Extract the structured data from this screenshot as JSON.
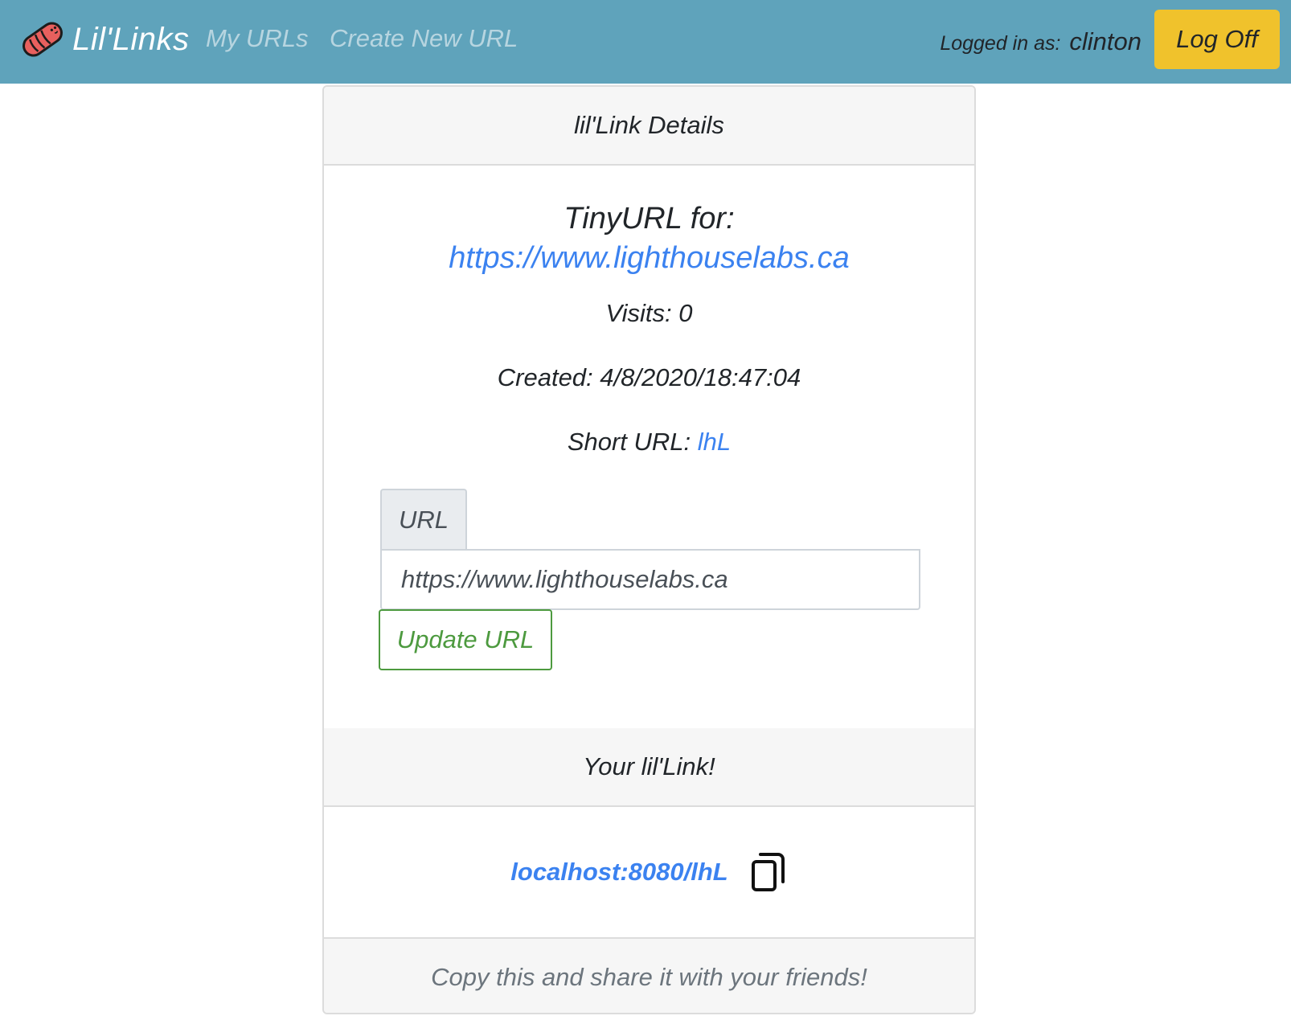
{
  "navbar": {
    "brand_text": "Lil'Links",
    "brand_icon": "sausage-icon",
    "links": [
      "My URLs",
      "Create New URL"
    ],
    "logged_in_label": "Logged in as:",
    "username": "clinton",
    "logoff_label": "Log Off",
    "colors": {
      "background": "#5fa3bb",
      "logoff": "#f0c22c"
    }
  },
  "details": {
    "header": "lil'Link Details",
    "tiny_title": "TinyURL for:",
    "long_url": "https://www.lighthouselabs.ca",
    "visits_text": "Visits: 0",
    "created_text": "Created: 4/8/2020/18:47:04",
    "short_url_label": "Short URL:",
    "short_url": "lhL"
  },
  "form": {
    "label": "URL",
    "value": "https://www.lighthouselabs.ca",
    "submit_label": "Update URL"
  },
  "share": {
    "header": "Your lil'Link!",
    "link": "localhost:8080/lhL",
    "copy_icon": "copy-icon",
    "footer": "Copy this and share it with your friends!"
  }
}
